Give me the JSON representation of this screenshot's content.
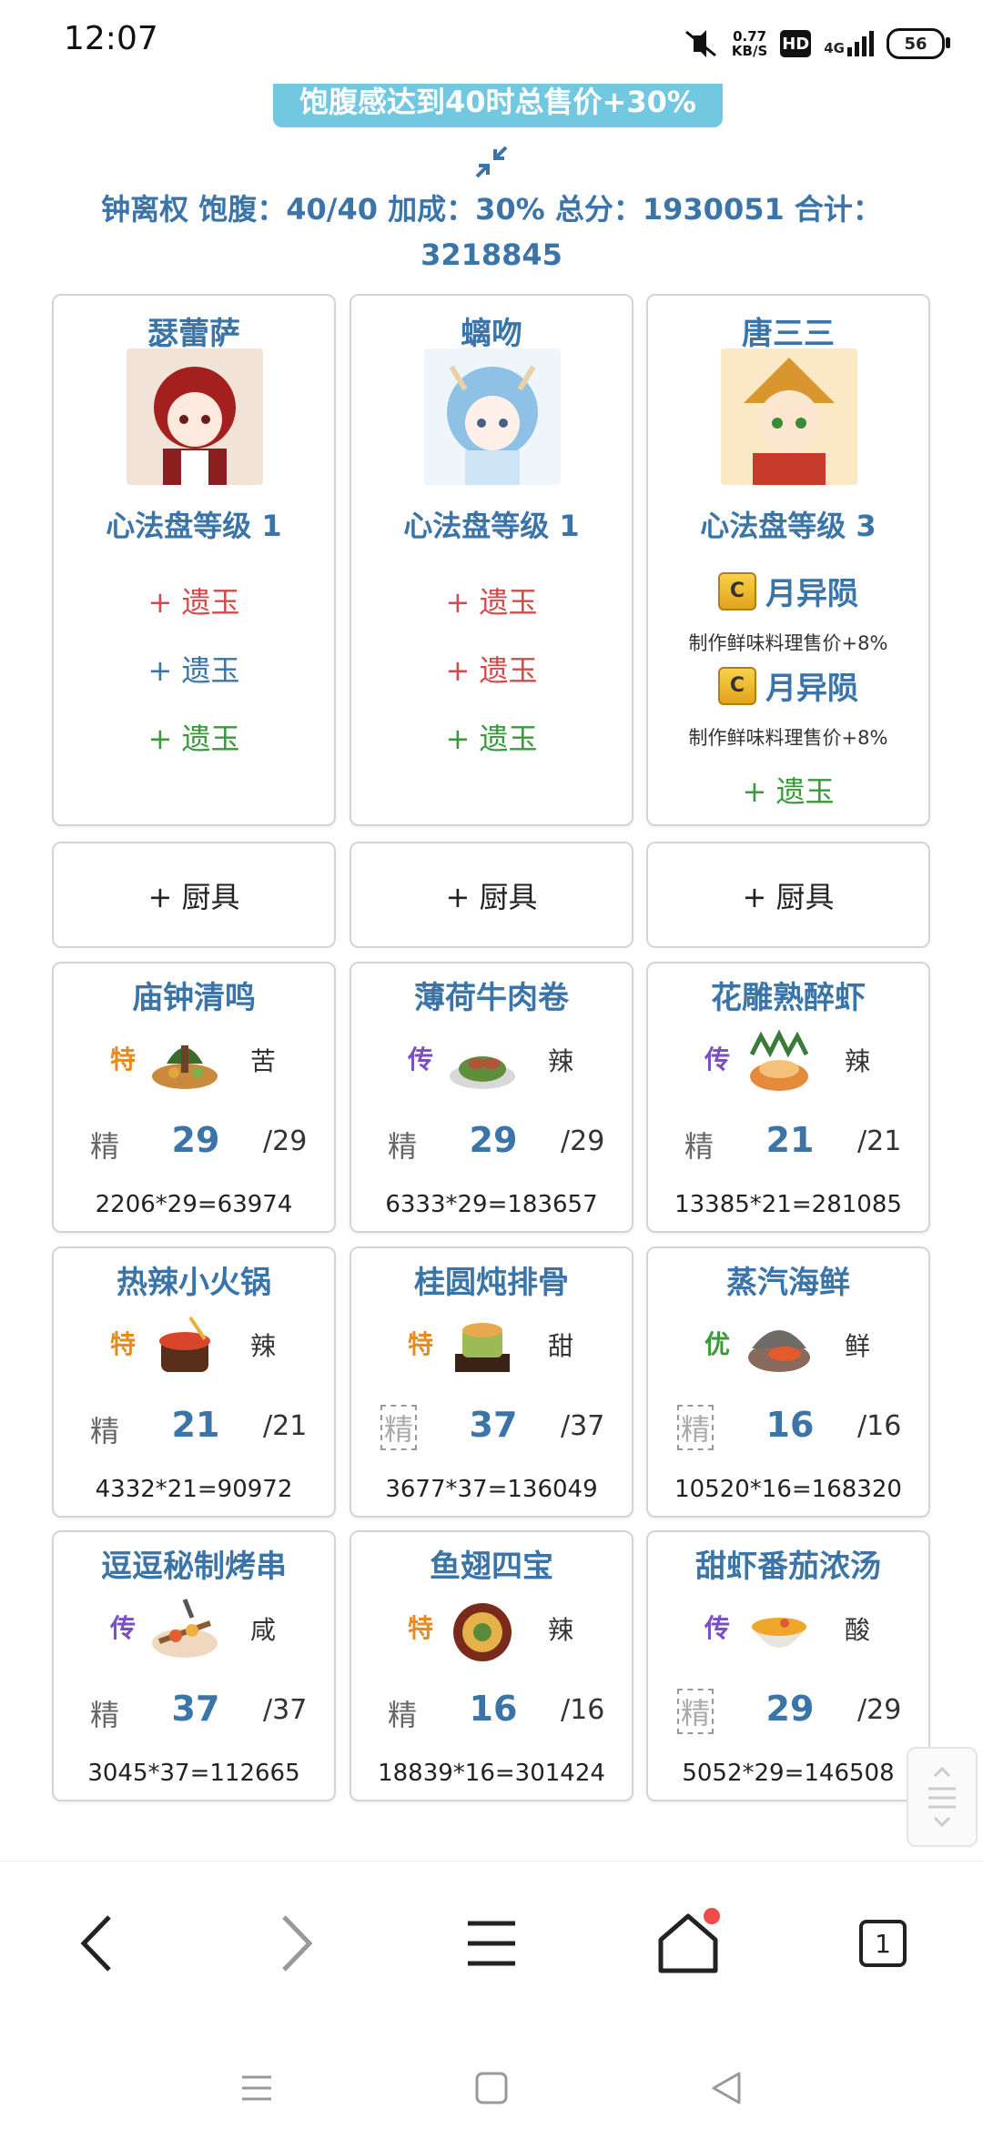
{
  "status": {
    "time": "12:07",
    "speed_value": "0.77",
    "speed_unit": "KB/S",
    "hd": "HD",
    "network": "4G",
    "battery": "56"
  },
  "header": {
    "banner": "饱腹感达到40时总售价+30%",
    "summary_line1": "钟离权 饱腹：40/40 加成：30% 总分：1930051 合计：",
    "summary_line2": "3218845"
  },
  "characters": [
    {
      "name": "瑟蕾萨",
      "level": "心法盘等级 1",
      "jade": [
        "+ 遗玉",
        "+ 遗玉",
        "+ 遗玉"
      ]
    },
    {
      "name": "螭吻",
      "level": "心法盘等级 1",
      "jade": [
        "+ 遗玉",
        "+ 遗玉",
        "+ 遗玉"
      ]
    },
    {
      "name": "唐三三",
      "level": "心法盘等级 3",
      "relics": [
        {
          "name": "月异陨",
          "desc": "制作鲜味料理售价+8%"
        },
        {
          "name": "月异陨",
          "desc": "制作鲜味料理售价+8%"
        }
      ],
      "jade": [
        "+ 遗玉"
      ]
    }
  ],
  "utensil_label": "+ 厨具",
  "dishes": [
    {
      "name": "庙钟清鸣",
      "grade": "特",
      "flavor": "苦",
      "jing": "精",
      "count": "29",
      "max": "/29",
      "formula": "2206*29=63974"
    },
    {
      "name": "薄荷牛肉卷",
      "grade": "传",
      "flavor": "辣",
      "jing": "精",
      "count": "29",
      "max": "/29",
      "formula": "6333*29=183657"
    },
    {
      "name": "花雕熟醉虾",
      "grade": "传",
      "flavor": "辣",
      "jing": "精",
      "count": "21",
      "max": "/21",
      "formula": "13385*21=281085"
    },
    {
      "name": "热辣小火锅",
      "grade": "特",
      "flavor": "辣",
      "jing": "精",
      "count": "21",
      "max": "/21",
      "formula": "4332*21=90972"
    },
    {
      "name": "桂圆炖排骨",
      "grade": "特",
      "flavor": "甜",
      "jing": "精",
      "count": "37",
      "max": "/37",
      "formula": "3677*37=136049"
    },
    {
      "name": "蒸汽海鲜",
      "grade": "优",
      "flavor": "鲜",
      "jing": "精",
      "count": "16",
      "max": "/16",
      "formula": "10520*16=168320"
    },
    {
      "name": "逗逗秘制烤串",
      "grade": "传",
      "flavor": "咸",
      "jing": "精",
      "count": "37",
      "max": "/37",
      "formula": "3045*37=112665"
    },
    {
      "name": "鱼翅四宝",
      "grade": "特",
      "flavor": "辣",
      "jing": "精",
      "count": "16",
      "max": "/16",
      "formula": "18839*16=301424"
    },
    {
      "name": "甜虾番茄浓汤",
      "grade": "传",
      "flavor": "酸",
      "jing": "精",
      "count": "29",
      "max": "/29",
      "formula": "5052*29=146508"
    }
  ],
  "nav": {
    "tab_count": "1"
  }
}
